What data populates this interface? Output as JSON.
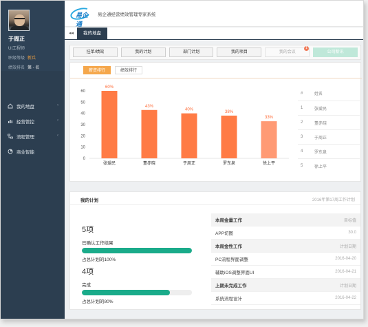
{
  "profile": {
    "name": "于周正",
    "role": "UI工程师",
    "level_label": "职级等级",
    "level_value": "新兵",
    "rank_label": "绩效排名",
    "rank_value": "第 - 名"
  },
  "sidebar": {
    "items": [
      {
        "label": "我的地盘",
        "icon": "home-icon",
        "arrow": "‹"
      },
      {
        "label": "经营管控",
        "icon": "bar-chart-icon",
        "arrow": "‹"
      },
      {
        "label": "流程管理",
        "icon": "flow-icon",
        "arrow": "‹"
      },
      {
        "label": "商业智能",
        "icon": "pie-icon",
        "arrow": ""
      }
    ]
  },
  "header": {
    "logo_text": "易企通",
    "app_title": "易企通经营绩效管理专家系统"
  },
  "tabbar": {
    "back_glyph": "◂◂",
    "active_tab": "我的地盘"
  },
  "nav": {
    "buttons": [
      "挂单/绩效",
      "我的计划",
      "部门计划",
      "我的项目",
      "我的会议",
      "公司新讯"
    ],
    "badge_count": "1"
  },
  "rank_tabs": {
    "active": "薪资排行",
    "other": "绩效排行"
  },
  "chart_data": {
    "type": "bar",
    "categories": [
      "张爱民",
      "董赤晓",
      "于周正",
      "罗东泉",
      "徐上平"
    ],
    "values": [
      60,
      43,
      40,
      38,
      33
    ],
    "data_labels": [
      "60%",
      "43%",
      "40%",
      "38%",
      "33%"
    ],
    "ylim": [
      0,
      60
    ],
    "yticks": [
      0,
      10,
      20,
      30,
      40,
      50,
      60
    ],
    "colors": [
      "#ff7b45",
      "#ff7b45",
      "#ff7b45",
      "#ff7b45",
      "#ff9a74"
    ],
    "label_color": "#ff6a36"
  },
  "rank_table": {
    "headers": [
      "#",
      "姓名"
    ],
    "rows": [
      [
        "1",
        "张爱民"
      ],
      [
        "2",
        "董赤晓"
      ],
      [
        "3",
        "于周正"
      ],
      [
        "4",
        "罗东泉"
      ],
      [
        "5",
        "徐上平"
      ]
    ]
  },
  "plan": {
    "title": "我的计划",
    "week": "2016年第17周工作计划",
    "stats": [
      {
        "count": "5项",
        "label": "已确认工作结果",
        "percent": 100,
        "percent_text": "占总计划的100%"
      },
      {
        "count": "4项",
        "label": "完成",
        "percent": 80,
        "percent_text": "占总计划的80%"
      }
    ],
    "tasks": [
      {
        "text": "本周金量工作",
        "right": "目标值",
        "head": true
      },
      {
        "text": "APP切图",
        "right": "30.0",
        "head": false
      },
      {
        "text": "本周金性工作",
        "right": "计划日期",
        "head": true
      },
      {
        "text": "PC流程界面调整",
        "right": "2016-04-20",
        "head": false
      },
      {
        "text": "辅助iOS调整界面UI",
        "right": "2016-04-21",
        "head": false
      },
      {
        "text": "上期未完成工作",
        "right": "计划日期",
        "head": true
      },
      {
        "text": "系统流程设计",
        "right": "2016-04-22",
        "head": false
      }
    ]
  }
}
